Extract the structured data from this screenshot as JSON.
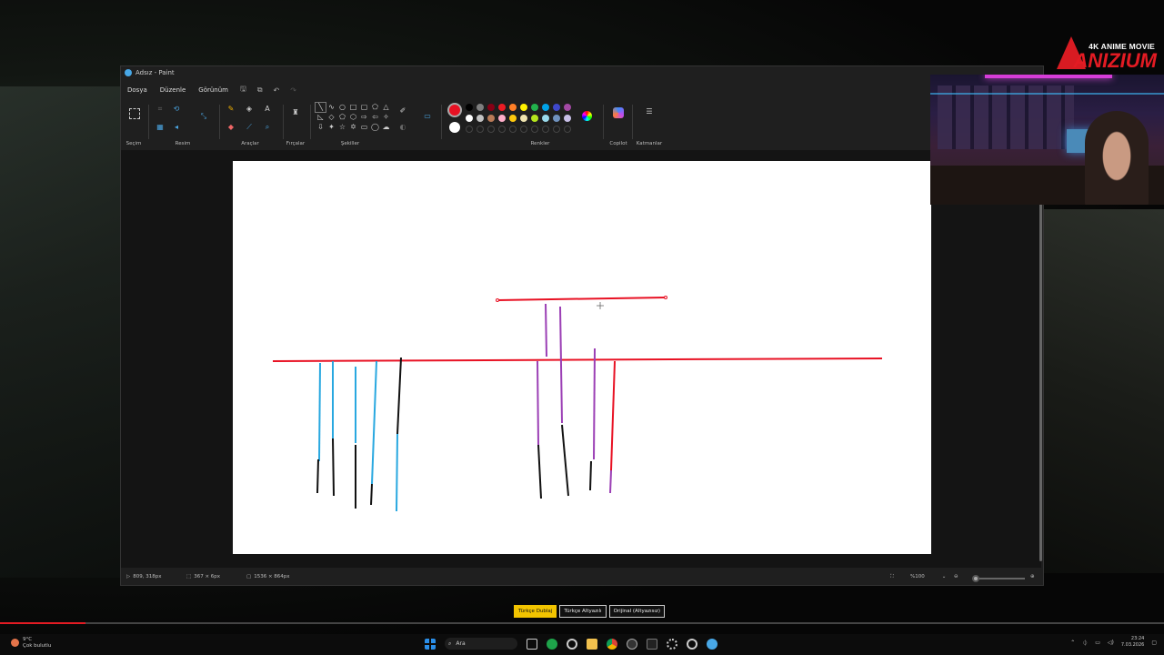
{
  "window": {
    "title": "Adsız - Paint"
  },
  "menu": {
    "file": "Dosya",
    "edit": "Düzenle",
    "view": "Görünüm"
  },
  "ribbon": {
    "selection": "Seçim",
    "image": "Resim",
    "tools": "Araçlar",
    "brushes": "Fırçalar",
    "shapes": "Şekiller",
    "colors": "Renkler",
    "copilot": "Copilot",
    "layers": "Katmanlar"
  },
  "palette": {
    "primary": "#e81123",
    "secondary": "#ffffff",
    "row1": [
      "#000000",
      "#7f7f7f",
      "#880015",
      "#ed1c24",
      "#ff7f27",
      "#fff200",
      "#22b14c",
      "#00a2e8",
      "#3f48cc",
      "#a349a4"
    ],
    "row2": [
      "#ffffff",
      "#c3c3c3",
      "#b97a57",
      "#ffaec9",
      "#ffc90e",
      "#efe4b0",
      "#b5e61d",
      "#99d9ea",
      "#7092be",
      "#c8bfe7"
    ]
  },
  "status": {
    "cursor_pos": "809, 318px",
    "selection_size": "367 × 6px",
    "canvas_size": "1536 × 864px",
    "zoom": "%100"
  },
  "logo": {
    "tagline": "4K ANIME MOVIE",
    "brand": "NIZIUM"
  },
  "subtitles": {
    "dub": "Türkçe Dublaj",
    "sub": "Türkçe Altyazılı",
    "original": "Orijinal (Altyazısız)"
  },
  "taskbar": {
    "weather_temp": "9°C",
    "weather_desc": "Çok bulutlu",
    "search": "Ara",
    "time": "23:24",
    "date": "7.03.2026"
  }
}
